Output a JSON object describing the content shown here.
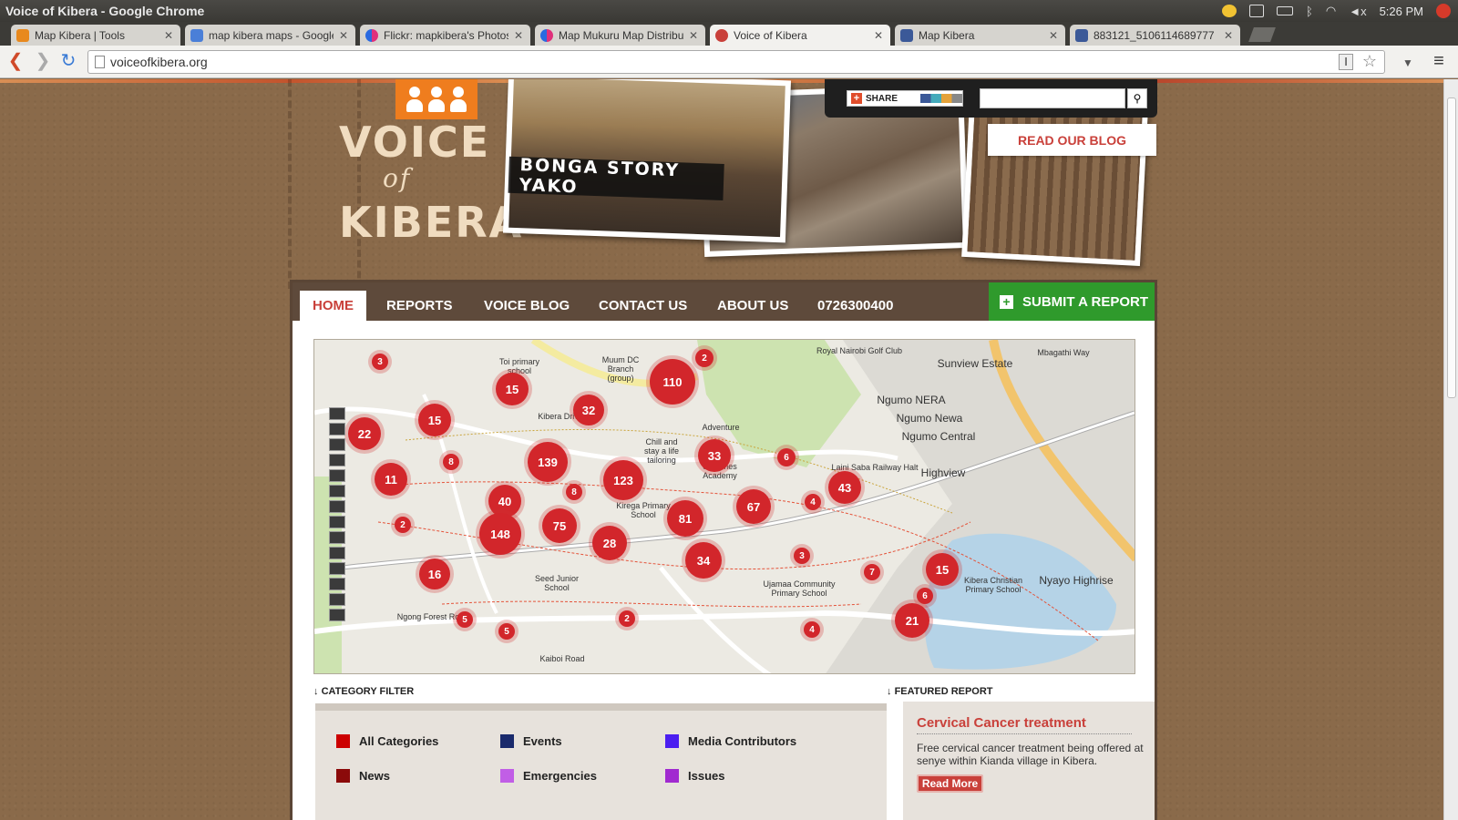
{
  "window": {
    "title": "Voice of Kibera - Google Chrome",
    "clock": "5:26 PM"
  },
  "tabs": [
    {
      "label": "Map Kibera | Tools",
      "color": "#e8891d"
    },
    {
      "label": "map kibera maps - Google",
      "color": "#4a7fd8"
    },
    {
      "label": "Flickr: mapkibera's Photos",
      "color": "#e0307b"
    },
    {
      "label": "Map Mukuru Map Distribu",
      "color": "#e0307b"
    },
    {
      "label": "Voice of Kibera",
      "color": "#c9403a",
      "active": true
    },
    {
      "label": "Map Kibera",
      "color": "#3b5998"
    },
    {
      "label": "883121_5106114689777",
      "color": "#3b5998"
    }
  ],
  "toolbar": {
    "url": "voiceofkibera.org"
  },
  "header": {
    "logo_line1": "VOICE",
    "logo_line2": "of",
    "logo_line3": "KIBERA",
    "story_banner": "BONGA STORY YAKO",
    "share_label": "SHARE",
    "search_placeholder": "",
    "blog_button": "READ OUR BLOG"
  },
  "nav": {
    "items": [
      "HOME",
      "REPORTS",
      "VOICE BLOG",
      "CONTACT US",
      "ABOUT US",
      "0726300400"
    ],
    "submit": "SUBMIT A REPORT"
  },
  "map": {
    "clusters": [
      {
        "count": "3"
      },
      {
        "count": "2"
      },
      {
        "count": "15"
      },
      {
        "count": "110"
      },
      {
        "count": "15"
      },
      {
        "count": "32"
      },
      {
        "count": "22"
      },
      {
        "count": "139"
      },
      {
        "count": "33"
      },
      {
        "count": "6"
      },
      {
        "count": "8"
      },
      {
        "count": "123"
      },
      {
        "count": "11"
      },
      {
        "count": "8"
      },
      {
        "count": "43"
      },
      {
        "count": "40"
      },
      {
        "count": "67"
      },
      {
        "count": "4"
      },
      {
        "count": "2"
      },
      {
        "count": "148"
      },
      {
        "count": "75"
      },
      {
        "count": "81"
      },
      {
        "count": "28"
      },
      {
        "count": "34"
      },
      {
        "count": "3"
      },
      {
        "count": "16"
      },
      {
        "count": "7"
      },
      {
        "count": "15"
      },
      {
        "count": "6"
      },
      {
        "count": "2"
      },
      {
        "count": "4"
      },
      {
        "count": "5"
      },
      {
        "count": "21"
      },
      {
        "count": "5"
      }
    ],
    "labels": {
      "royal": "Royal Nairobi Golf Club",
      "sunview": "Sunview Estate",
      "nera": "Ngumo NERA",
      "newa": "Ngumo Newa",
      "central": "Ngumo Central",
      "highview": "Highview",
      "mbagathi": "Mbagathi Way",
      "nyayo": "Nyayo Highrise",
      "railway": "Laini Saba Railway Halt",
      "toi": "Toi primary school",
      "muum": "Muum DC Branch (group)",
      "adventure": "Adventure",
      "chill": "Chill and stay a life tailoring",
      "stjames": "St James Academy",
      "ujamaa": "Ujamaa Community Primary School",
      "kibera_christian": "Kibera Christian Primary School",
      "seed": "Seed Junior School",
      "kirega": "Kirega Primary School",
      "ngong": "Ngong Forest Road",
      "kaiboi": "Kaiboi Road",
      "kibera_drive": "Kibera Drive"
    }
  },
  "category_filter": {
    "title": "CATEGORY FILTER",
    "items": [
      {
        "label": "All Categories",
        "color": "#cc0000"
      },
      {
        "label": "Events",
        "color": "#1a2a6c"
      },
      {
        "label": "Media Contributors",
        "color": "#4b1ef0"
      },
      {
        "label": "News",
        "color": "#8b0a0a"
      },
      {
        "label": "Emergencies",
        "color": "#c15ee6"
      },
      {
        "label": "Issues",
        "color": "#a12ad0"
      }
    ]
  },
  "featured": {
    "title": "FEATURED REPORT",
    "report_title": "Cervical Cancer treatment",
    "body": "Free cervical cancer treatment being offered at senye within Kianda village in Kibera.",
    "button": "Read More"
  }
}
